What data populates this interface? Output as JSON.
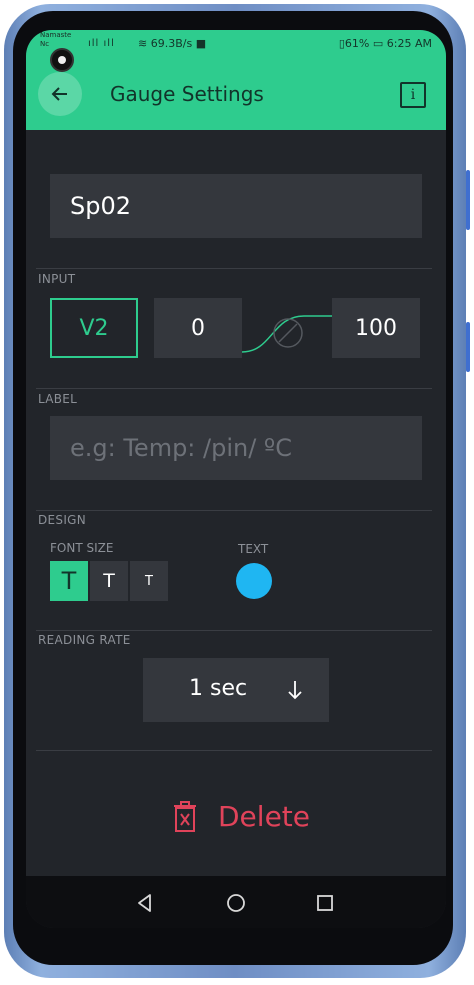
{
  "status_bar": {
    "carrier_line1": "Namaste",
    "carrier_line2": "Nc",
    "signal": "ıll ıll",
    "speed": "69.3B/s",
    "battery": "61%",
    "time": "6:25 AM"
  },
  "app_bar": {
    "title": "Gauge Settings",
    "info_label": "i"
  },
  "widget": {
    "name": "Sp02"
  },
  "input": {
    "section_label": "INPUT",
    "pin": "V2",
    "min": "0",
    "max": "100"
  },
  "label": {
    "section_label": "LABEL",
    "placeholder": "e.g: Temp: /pin/ ºC"
  },
  "design": {
    "section_label": "DESIGN",
    "font_size_label": "FONT SIZE",
    "font_sizes": [
      "T",
      "T",
      "T"
    ],
    "selected_font_size_index": 0,
    "text_color_label": "TEXT",
    "text_color": "#1fb6f2"
  },
  "reading_rate": {
    "section_label": "READING RATE",
    "value": "1 sec"
  },
  "delete": {
    "label": "Delete"
  },
  "colors": {
    "accent": "#2ecc8e",
    "background": "#22252a",
    "danger": "#e0435a"
  }
}
